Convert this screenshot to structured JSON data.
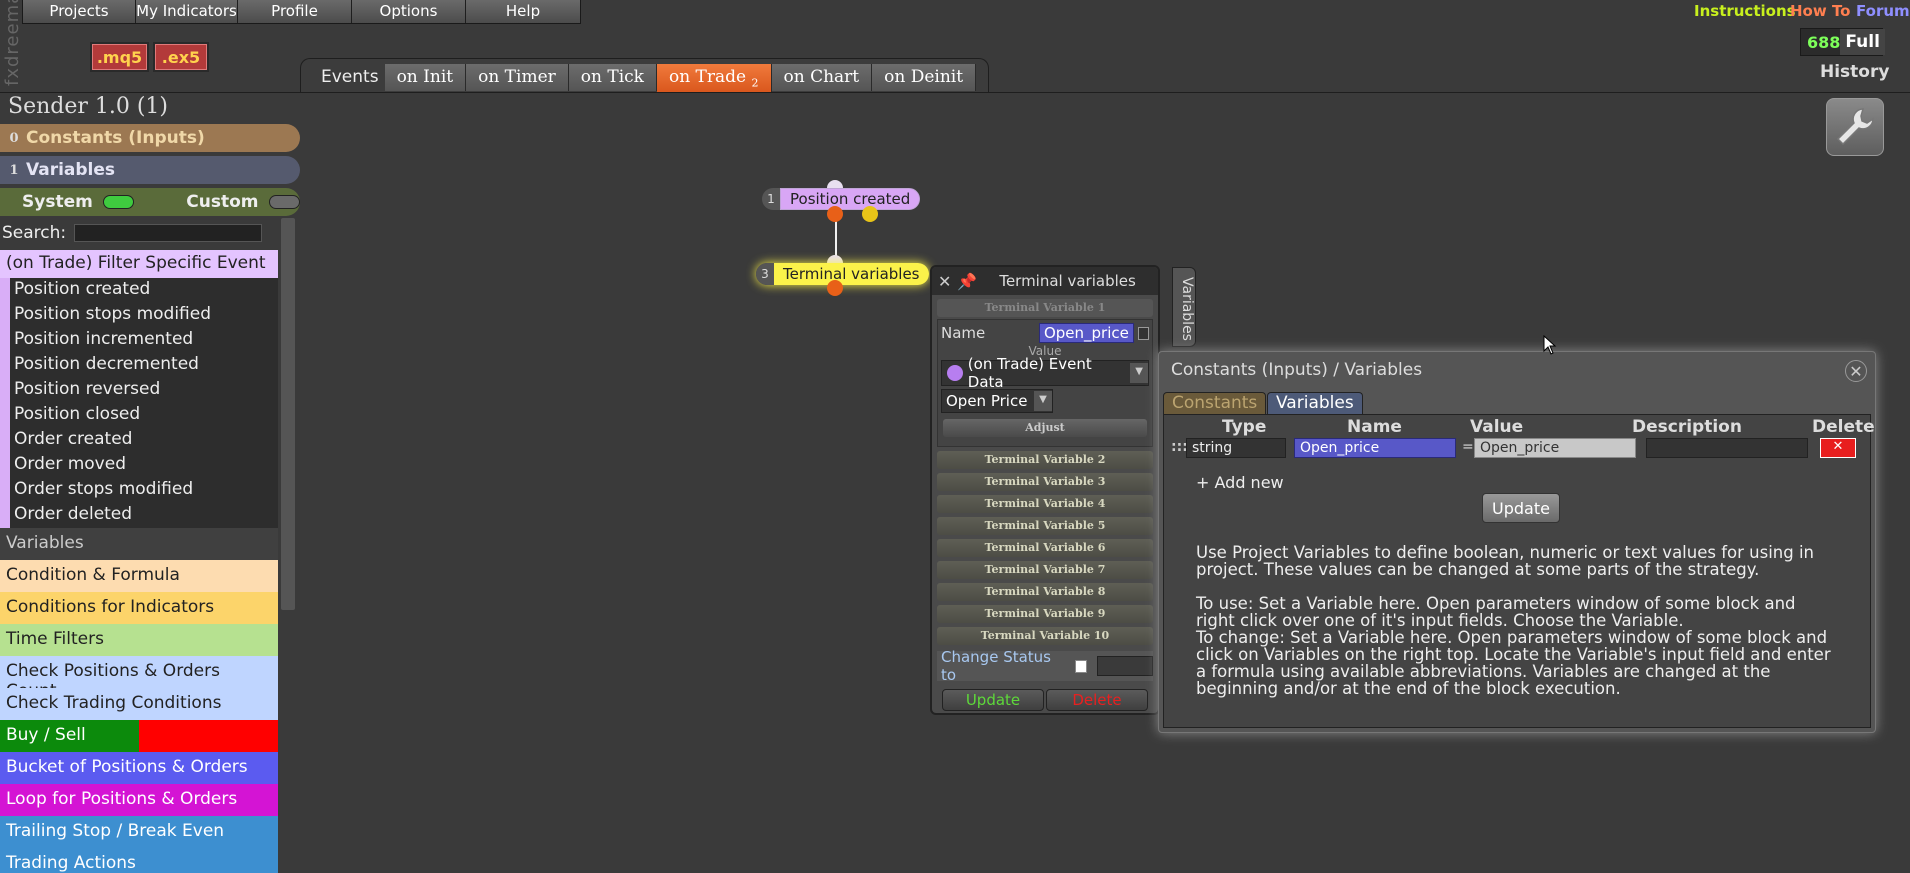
{
  "app": {
    "logo_text": "fxdreema",
    "mq5_label": ".mq5",
    "ex5_label": ".ex5"
  },
  "top_menu": [
    "Projects",
    "My Indicators",
    "Profile",
    "Options",
    "Help"
  ],
  "top_links": {
    "instructions": "Instructions",
    "how_to": "How To",
    "forum": "Forum"
  },
  "counter": {
    "value": "688",
    "full": "Full"
  },
  "history_label": "History",
  "events": {
    "label": "Events",
    "tabs": [
      {
        "label": "on Init",
        "active": false
      },
      {
        "label": "on Timer",
        "active": false
      },
      {
        "label": "on Tick",
        "active": false
      },
      {
        "label": "on Trade",
        "badge": "2",
        "active": true
      },
      {
        "label": "on Chart",
        "active": false
      },
      {
        "label": "on Deinit",
        "active": false
      }
    ]
  },
  "project": {
    "title": "Sender 1.0 (1)"
  },
  "sidebar": {
    "constants": {
      "count": "0",
      "label": "Constants (Inputs)"
    },
    "variables": {
      "count": "1",
      "label": "Variables"
    },
    "system_label": "System",
    "custom_label": "Custom",
    "search_label": "Search:",
    "filter_header": "(on Trade) Filter Specific Event",
    "events": [
      "Position created",
      "Position stops modified",
      "Position incremented",
      "Position decremented",
      "Position reversed",
      "Position closed",
      "Order created",
      "Order moved",
      "Order stops modified",
      "Order deleted"
    ],
    "variables_header": "Variables",
    "categories": [
      {
        "label": "Condition & Formula",
        "color": "#fddcb0"
      },
      {
        "label": "Conditions for Indicators",
        "color": "#fcd46a"
      },
      {
        "label": "Time Filters",
        "color": "#b6e190"
      },
      {
        "label": "Check Positions & Orders Count",
        "color": "#bfd5ff"
      },
      {
        "label": "Check Trading Conditions",
        "color": "#bfd5ff"
      },
      {
        "label": "Buy / Sell",
        "color": "#0c8a0c"
      },
      {
        "label": "Bucket of Positions & Orders",
        "color": "#5b5bf0"
      },
      {
        "label": "Loop for Positions & Orders",
        "color": "#d414d4"
      },
      {
        "label": "Trailing Stop / Break Even",
        "color": "#3d8fd0"
      },
      {
        "label": "Trading Actions",
        "color": "#3d8fd0"
      }
    ]
  },
  "canvas": {
    "nodes": [
      {
        "num": "1",
        "label": "Position created",
        "color": "#d8a6f5"
      },
      {
        "num": "3",
        "label": "Terminal variables",
        "color": "#fbf24a"
      }
    ]
  },
  "terminal_panel": {
    "title": "Terminal variables",
    "side_tab": "Variables",
    "var1_header": "Terminal Variable 1",
    "name_label": "Name",
    "name_value": "Open_price",
    "value_label": "Value",
    "source_select": "(on Trade) Event Data",
    "field_select": "Open Price",
    "adjust_label": "Adjust",
    "other_vars": [
      "Terminal Variable 2",
      "Terminal Variable 3",
      "Terminal Variable 4",
      "Terminal Variable 5",
      "Terminal Variable 6",
      "Terminal Variable 7",
      "Terminal Variable 8",
      "Terminal Variable 9",
      "Terminal Variable 10"
    ],
    "change_status_label": "Change Status to",
    "update_label": "Update",
    "delete_label": "Delete"
  },
  "cv_dialog": {
    "title": "Constants (Inputs) / Variables",
    "tabs": [
      "Constants",
      "Variables"
    ],
    "columns": [
      "Type",
      "Name",
      "Value",
      "Description",
      "Delete"
    ],
    "row": {
      "handle": ":::",
      "type": "string",
      "name": "Open_price",
      "equals": "=",
      "value": "Open_price",
      "description": ""
    },
    "add_new": "+ Add new",
    "update_label": "Update",
    "help": [
      "Use Project Variables to define boolean, numeric or text values for using in project. These values can be changed at some parts of the strategy.",
      "To use: Set a Variable here. Open parameters window of some block and right click over one of it's input fields. Choose the Variable.",
      "To change: Set a Variable here. Open parameters window of some block and click on Variables on the right top. Locate the Variable's input field and enter a formula using available abbreviations. Variables are changed at the beginning and/or at the end of the block execution."
    ]
  }
}
